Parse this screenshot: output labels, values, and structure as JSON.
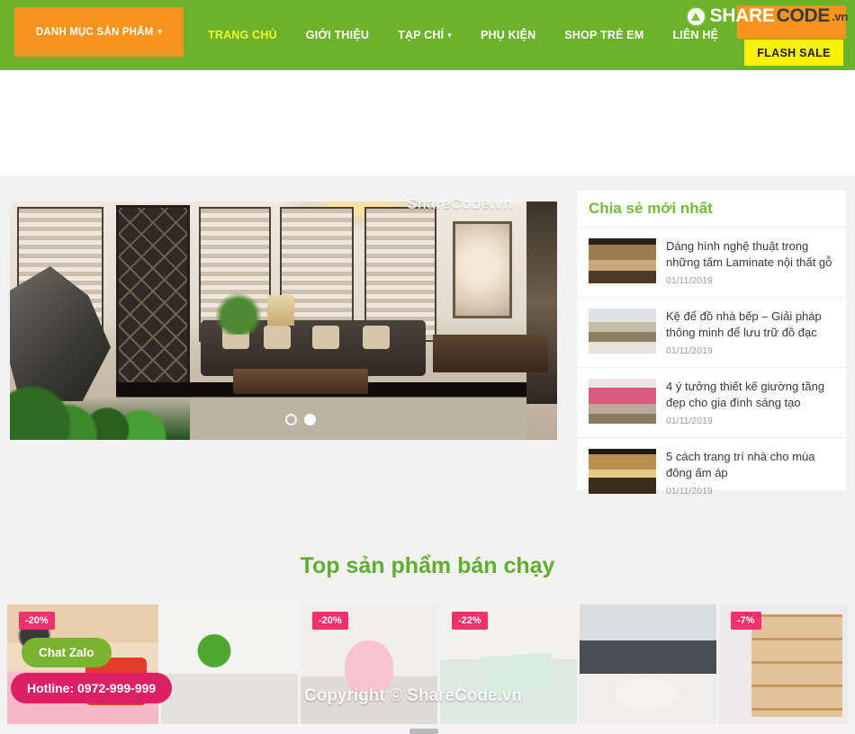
{
  "nav": {
    "category_button": {
      "label": "DANH MỤC SẢN PHẨM",
      "caret": "chevron-down-icon"
    },
    "items": [
      {
        "label": "TRANG CHỦ",
        "active": true,
        "caret": false
      },
      {
        "label": "GIỚI THIỆU",
        "active": false,
        "caret": false
      },
      {
        "label": "TẠP CHÍ",
        "active": false,
        "caret": true
      },
      {
        "label": "PHỤ KIỆN",
        "active": false,
        "caret": false
      },
      {
        "label": "SHOP TRẺ EM",
        "active": false,
        "caret": false
      },
      {
        "label": "LIÊN HỆ",
        "active": false,
        "caret": false
      }
    ],
    "flash_sale": "FLASH SALE"
  },
  "logo": {
    "part1": "SHARE",
    "part2": "CODE",
    "part3": ".vn",
    "mark": "leaf-icon"
  },
  "watermarks": {
    "hero": "ShareCode.vn",
    "products": "Copyright © ShareCode.vn"
  },
  "hero": {
    "slide_alt": "Phòng khách nội thất gỗ hiện đại",
    "dots": [
      {
        "active": false
      },
      {
        "active": true
      }
    ]
  },
  "sidebar": {
    "title": "Chia sẻ mới nhất",
    "posts": [
      {
        "title": "Dáng hình nghệ thuật trong những tấm Laminate nội thất gỗ",
        "date": "01/11/2019",
        "thumb": "t1"
      },
      {
        "title": "Kệ để đồ nhà bếp – Giải pháp thông minh để lưu trữ đồ đạc",
        "date": "01/11/2019",
        "thumb": "t2"
      },
      {
        "title": "4 ý tưởng thiết kế giường tầng đẹp cho gia đình sáng tạo",
        "date": "01/11/2019",
        "thumb": "t3"
      },
      {
        "title": "5 cách trang trí nhà cho mùa đông ấm áp",
        "date": "01/11/2019",
        "thumb": "t4"
      }
    ]
  },
  "products_section": {
    "title": "Top sản phẩm bán chạy",
    "items": [
      {
        "discount": "-20%",
        "art": "p1",
        "has_badge": true
      },
      {
        "discount": "",
        "art": "p2",
        "has_badge": false
      },
      {
        "discount": "-20%",
        "art": "p3",
        "has_badge": true
      },
      {
        "discount": "-22%",
        "art": "p4",
        "has_badge": true
      },
      {
        "discount": "",
        "art": "p5",
        "has_badge": false
      },
      {
        "discount": "-7%",
        "art": "p6",
        "has_badge": true
      }
    ]
  },
  "contact": {
    "zalo": "Chat Zalo",
    "hotline": "Hotline: 0972-999-999"
  },
  "colors": {
    "nav_green": "#6cb22b",
    "orange": "#f7941e",
    "flash_yellow": "#fbf204",
    "active_link": "#f5f52a",
    "title_green": "#5fae2e",
    "sidebar_title_green": "#72b93c",
    "badge_pink": "#f4306d",
    "zalo_green": "#7ab32f",
    "hotline_pink": "#dd1f63",
    "page_bg": "#f2f2f2"
  }
}
